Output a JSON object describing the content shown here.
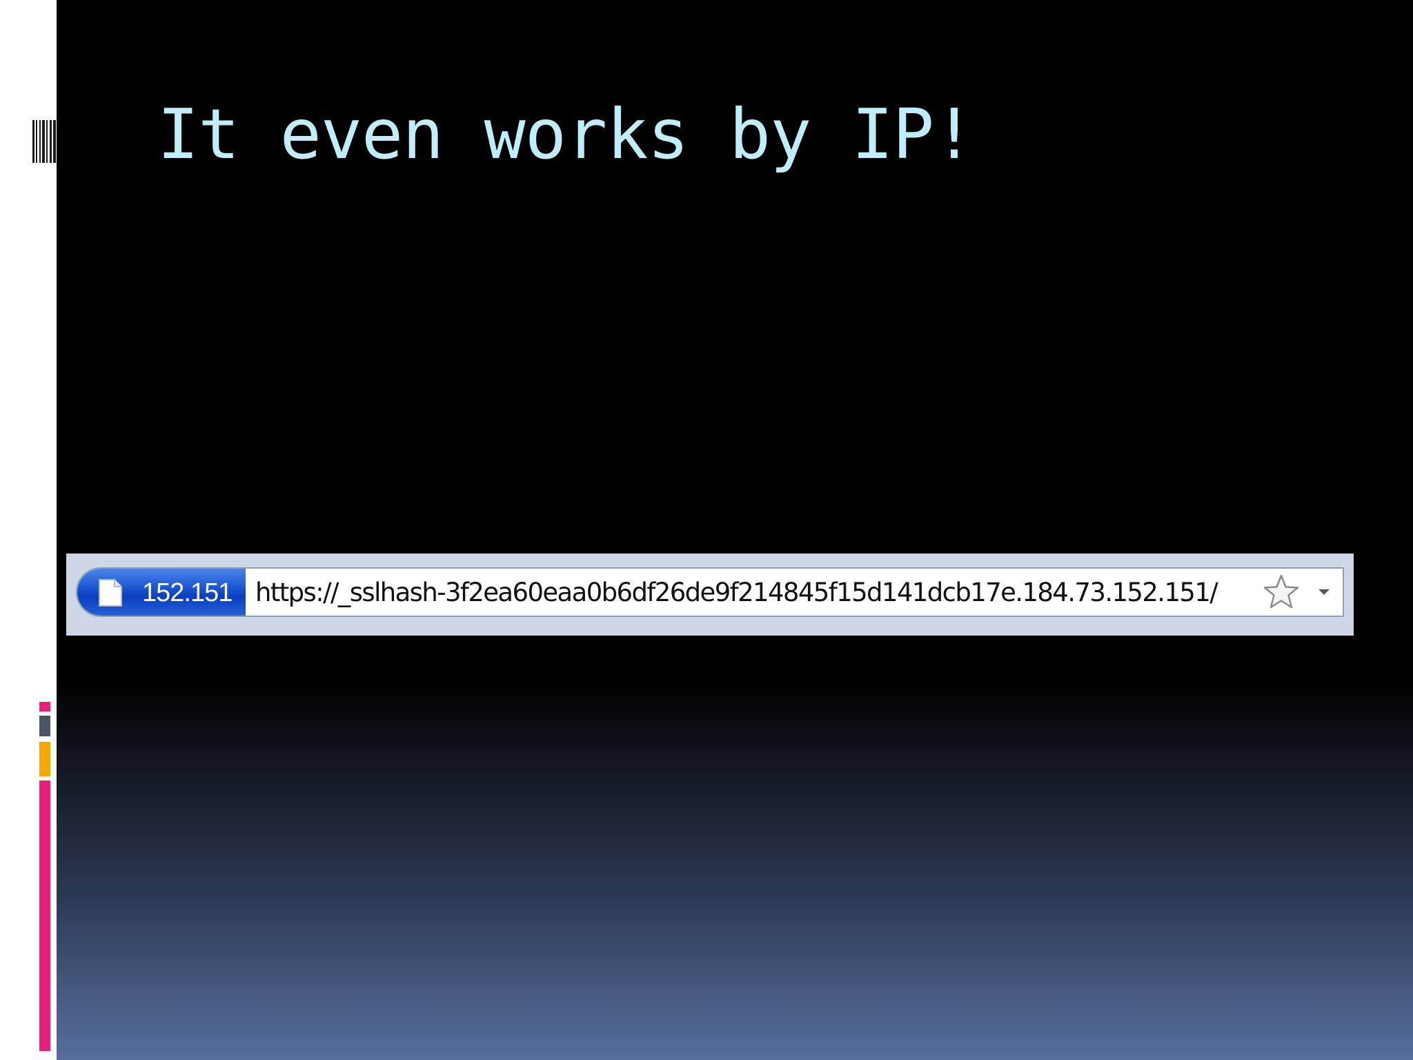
{
  "slide": {
    "title": "It even works by IP!",
    "title_color": "#bfeefa"
  },
  "address_bar": {
    "identity_label": "152.151",
    "url": "https://_sslhash-3f2ea60eaa0b6df26de9f214845f15d141dcb17e.184.73.152.151/",
    "identity_color": "#1c57d2",
    "icons": {
      "page": "page-icon",
      "bookmark": "star-icon",
      "history": "dropdown-arrow-icon"
    }
  },
  "decor": {
    "accent_colors": [
      "#e8207a",
      "#4d5560",
      "#f5a800",
      "#e8207a"
    ]
  }
}
